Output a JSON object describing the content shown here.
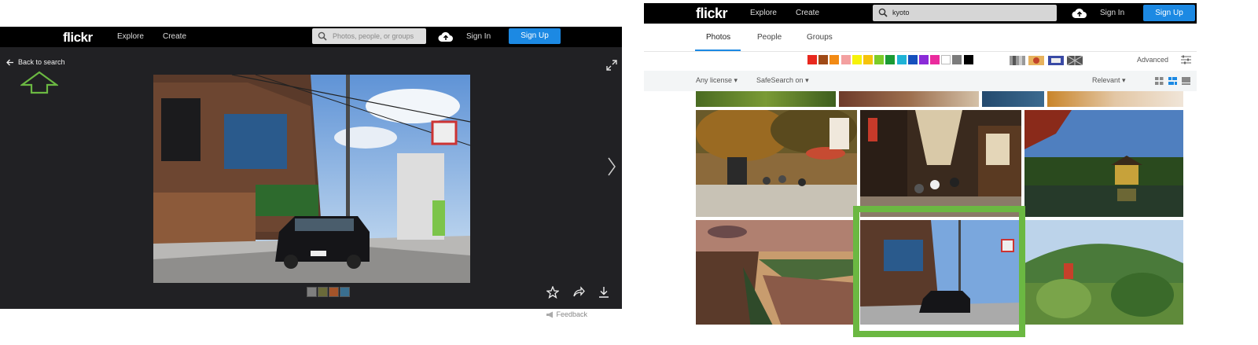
{
  "left": {
    "logo": "flickr",
    "nav": {
      "explore": "Explore",
      "create": "Create"
    },
    "search": {
      "placeholder": "Photos, people, or groups"
    },
    "signin": "Sign In",
    "signup": "Sign Up",
    "back_label": "Back to search",
    "colors": {
      "bg": "#212124",
      "topbar": "#000000",
      "brand": "#1c89e3",
      "annotation": "#6bb842"
    }
  },
  "right": {
    "logo": "flickr",
    "nav": {
      "explore": "Explore",
      "create": "Create"
    },
    "search": {
      "value": "kyoto"
    },
    "signin": "Sign In",
    "signup": "Sign Up",
    "tabs": [
      {
        "label": "Photos",
        "active": true
      },
      {
        "label": "People"
      },
      {
        "label": "Groups"
      }
    ],
    "color_swatches": [
      "#e8281e",
      "#a04a16",
      "#f28a14",
      "#f3a0a0",
      "#f6f20a",
      "#f6c30b",
      "#7ccc29",
      "#1a9a34",
      "#1fb3d6",
      "#1650bd",
      "#8b2bd8",
      "#ea2b9d",
      "#ffffff",
      "#7c7c7c",
      "#000000"
    ],
    "advanced_label": "Advanced",
    "filters": {
      "license": "Any license",
      "safesearch": "SafeSearch on",
      "sort": "Relevant"
    },
    "feedback": "Feedback",
    "colors": {
      "highlight": "#6bb842",
      "filterbar": "#f3f5f6"
    }
  }
}
